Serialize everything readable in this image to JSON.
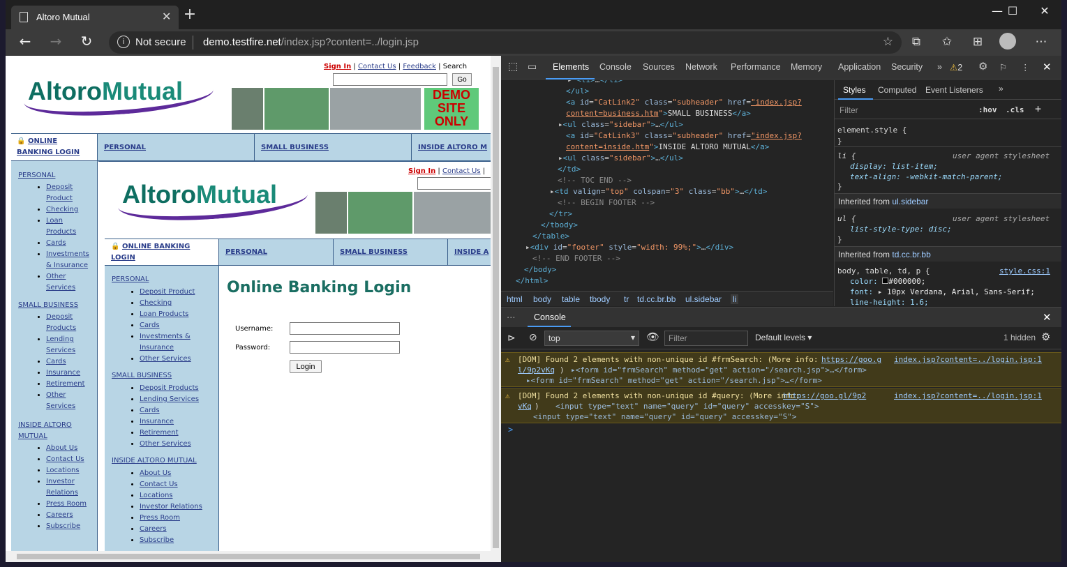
{
  "browser": {
    "tab_title": "Altoro Mutual",
    "not_secure": "Not secure",
    "url_host": "demo.testfire.net",
    "url_path": "/index.jsp?content=../login.jsp"
  },
  "site": {
    "top_links": {
      "sign_in": "Sign In",
      "contact": "Contact Us",
      "feedback": "Feedback",
      "search": "Search",
      "go": "Go"
    },
    "logo_a": "Altoro",
    "logo_b": "Mutual",
    "demo": [
      "DEMO",
      "SITE",
      "ONLY"
    ],
    "nav": {
      "login_a": "ONLINE",
      "login_b": "BANKING LOGIN",
      "personal": "PERSONAL",
      "small_business": "SMALL BUSINESS",
      "inside": "INSIDE ALTORO M"
    },
    "sidebar": {
      "personal": "PERSONAL",
      "personal_items": [
        "Deposit",
        "Product",
        "Checking",
        "Loan",
        "Products",
        "Cards",
        "Investments",
        "& Insurance",
        "Other",
        "Services"
      ],
      "small_business": "SMALL BUSINESS",
      "sb_items": [
        "Deposit",
        "Products",
        "Lending",
        "Services",
        "Cards",
        "Insurance",
        "Retirement",
        "Other",
        "Services"
      ],
      "inside_a": "INSIDE ALTORO",
      "inside_b": "MUTUAL",
      "inside_items": [
        "About Us",
        "Contact Us",
        "Locations",
        "Investor",
        "Relations",
        "Press Room",
        "Careers",
        "Subscribe"
      ]
    },
    "inner": {
      "sign_in": "Sign In",
      "contact": "Contact Us",
      "nav_login_a": "ONLINE BANKING",
      "nav_login_b": "LOGIN",
      "nav_personal": "PERSONAL",
      "nav_sb": "SMALL BUSINESS",
      "nav_inside": "INSIDE A",
      "personal": "PERSONAL",
      "personal_items": [
        "Deposit Product",
        "Checking",
        "Loan Products",
        "Cards",
        "Investments &",
        "Insurance",
        "Other Services"
      ],
      "small_business": "SMALL BUSINESS",
      "sb_items": [
        "Deposit Products",
        "Lending Services",
        "Cards",
        "Insurance",
        "Retirement",
        "Other Services"
      ],
      "inside": "INSIDE ALTORO MUTUAL",
      "inside_items": [
        "About Us",
        "Contact Us",
        "Locations",
        "Investor Relations",
        "Press Room",
        "Careers",
        "Subscribe"
      ],
      "heading": "Online Banking Login",
      "username_label": "Username:",
      "password_label": "Password:",
      "login_button": "Login"
    }
  },
  "devtools": {
    "tabs": [
      "Elements",
      "Console",
      "Sources",
      "Network",
      "Performance",
      "Memory",
      "Application",
      "Security"
    ],
    "warn_count": "2",
    "breadcrumbs": [
      "html",
      "body",
      "table",
      "tbody",
      "tr",
      "td.cc.br.bb",
      "ul.sidebar",
      "li"
    ],
    "styles_tabs": [
      "Styles",
      "Computed",
      "Event Listeners"
    ],
    "filter": "Filter",
    "hov": ":hov",
    "cls": ".cls",
    "element_style": "element.style {",
    "li_rule": "li {",
    "ua": "user agent stylesheet",
    "display": "display: list-item;",
    "text_align": "text-align: -webkit-match-parent;",
    "inherited1": "Inherited from",
    "inherited1_sel": "ul.sidebar",
    "ul_rule": "ul {",
    "list_style": "list-style-type: disc;",
    "inherited2_sel": "td.cc.br.bb",
    "body_rule": "body, table, td, p {",
    "style_src": "style.css:1",
    "color_prop": "color:",
    "color_val": "#000000;",
    "font_prop": "font:",
    "font_val": "10px Verdana, Arial, Sans-Serif;",
    "lh": "line-height: 1.6;",
    "console_tab": "Console",
    "context": "top",
    "console_filter": "Filter",
    "levels": "Default levels",
    "hidden": "1 hidden",
    "warn1": {
      "text": "[DOM] Found 2 elements with non-unique id #frmSearch: (More info:",
      "link": "https://goo.g",
      "link2": "l/9p2vKq",
      "src": "index.jsp?content=../login.jsp:1",
      "node1": "<form id=\"frmSearch\" method=\"get\" action=\"/search.jsp\">…</form>",
      "node2": "<form id=\"frmSearch\" method=\"get\" action=\"/search.jsp\">…</form>"
    },
    "warn2": {
      "text": "[DOM] Found 2 elements with non-unique id #query: (More info:",
      "link": "https://goo.gl/9p2",
      "link2": "vKq",
      "src": "index.jsp?content=../login.jsp:1",
      "node1": "<input type=\"text\" name=\"query\" id=\"query\" accesskey=\"S\">",
      "node2": "<input type=\"text\" name=\"query\" id=\"query\" accesskey=\"S\">"
    },
    "prompt": ">"
  }
}
